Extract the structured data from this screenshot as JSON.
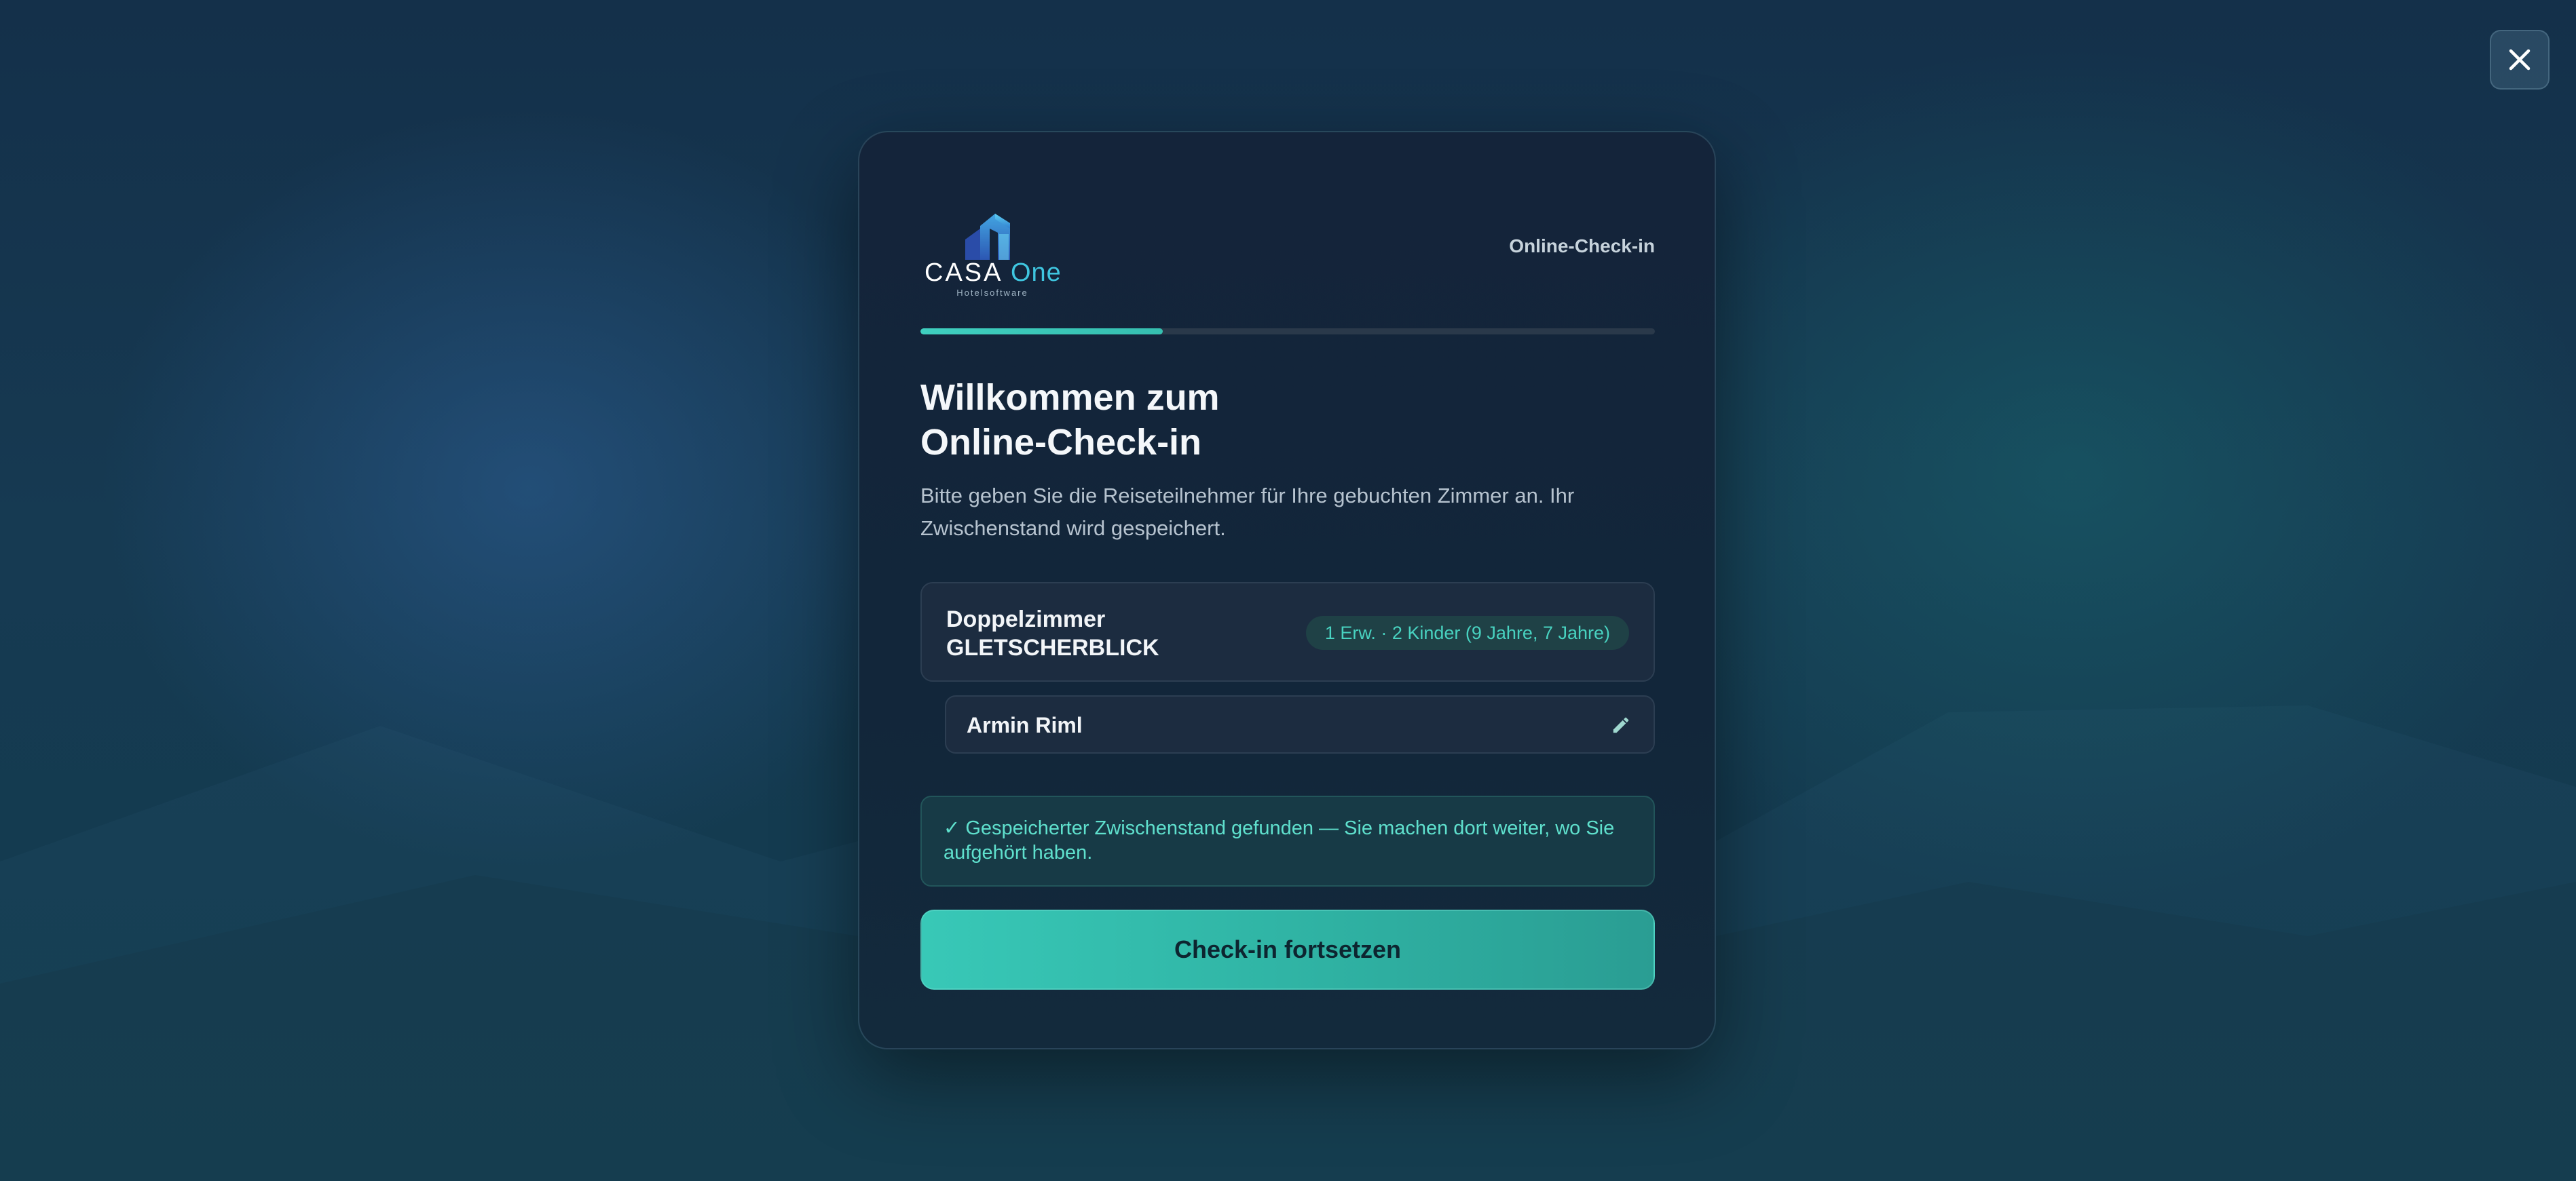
{
  "app": {
    "brand_name": "CASA",
    "brand_suffix": "One",
    "brand_tagline": "Hotelsoftware",
    "header_label": "Online-Check-in"
  },
  "progress": {
    "value": 0.33,
    "accent": "#3fcfbf"
  },
  "welcome": {
    "title_line1": "Willkommen zum",
    "title_line2": "Online-Check-in",
    "description": "Bitte geben Sie die Reiseteilnehmer für Ihre gebuchten Zimmer an. Ihr Zwischenstand wird gespeichert."
  },
  "room": {
    "name_line1": "Doppelzimmer",
    "name_line2": "GLETSCHERBLICK",
    "occupancy": "1 Erw. · 2 Kinder (9 Jahre, 7 Jahre)",
    "guests": [
      {
        "name": "Armin Riml",
        "action_icon": "pencil-icon"
      }
    ]
  },
  "notice": {
    "text": "✓ Gespeicherter Zwischenstand gefunden — Sie machen dort weiter, wo Sie aufgehört haben."
  },
  "actions": {
    "continue_label": "Check-in fortsetzen",
    "close_icon": "close-icon"
  },
  "colors": {
    "accent": "#3fcfbf",
    "brand_blue": "#3fc6e0",
    "card_background": "#14243a"
  }
}
